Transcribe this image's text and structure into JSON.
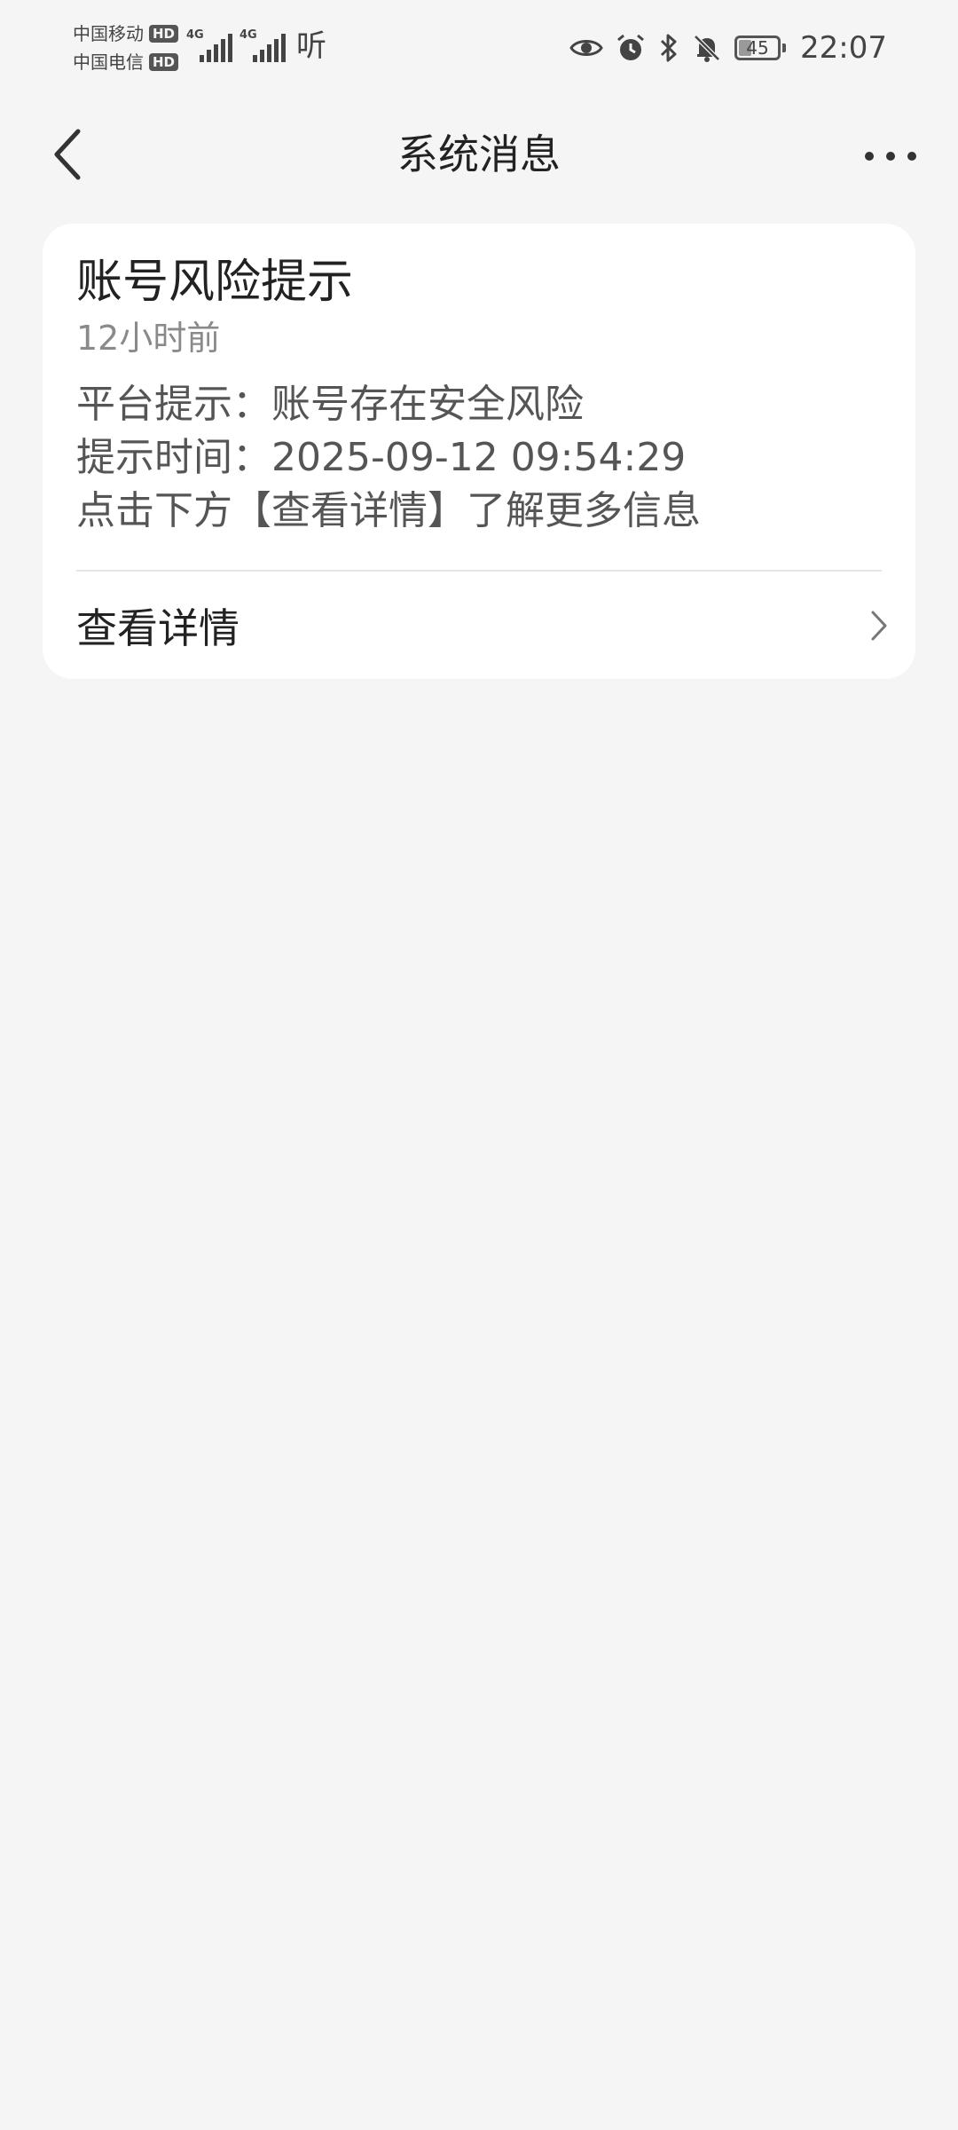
{
  "status_bar": {
    "carriers": [
      {
        "name": "中国移动",
        "badge": "HD"
      },
      {
        "name": "中国电信",
        "badge": "HD"
      }
    ],
    "signal_1": {
      "generation": "4G"
    },
    "signal_2": {
      "generation": "4G"
    },
    "listen_label": "听",
    "battery_level": "45",
    "time": "22:07",
    "icons": [
      "eye-icon",
      "alarm-icon",
      "bluetooth-icon",
      "bell-off-icon",
      "battery-icon"
    ]
  },
  "header": {
    "title": "系统消息",
    "back_icon": "back-arrow-icon",
    "more_icon": "more-dots-icon"
  },
  "message": {
    "title": "账号风险提示",
    "time": "12小时前",
    "lines": [
      "平台提示：账号存在安全风险",
      "提示时间：2025-09-12 09:54:29",
      "点击下方【查看详情】了解更多信息"
    ],
    "action_label": "查看详情",
    "action_icon": "chevron-right-icon"
  },
  "colors": {
    "background": "#f5f5f5",
    "card": "#ffffff",
    "text_primary": "#222222",
    "text_secondary": "#8a8a8a"
  }
}
